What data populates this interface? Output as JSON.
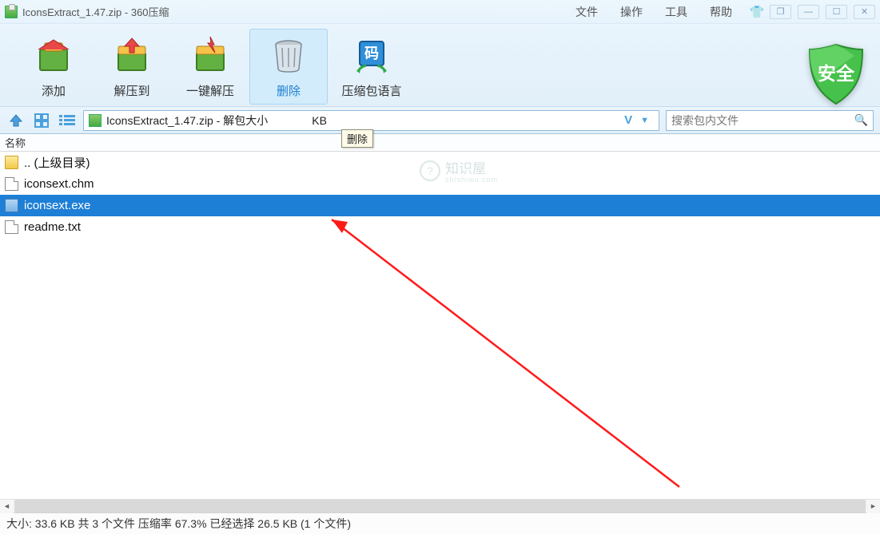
{
  "title": "IconsExtract_1.47.zip - 360压缩",
  "menus": {
    "file": "文件",
    "operation": "操作",
    "tools": "工具",
    "help": "帮助"
  },
  "toolbar": {
    "add": "添加",
    "extract_to": "解压到",
    "one_click_extract": "一键解压",
    "delete": "删除",
    "package_language": "压缩包语言"
  },
  "safe_label": "安全",
  "location": {
    "text_before": "IconsExtract_1.47.zip - 解包大小",
    "text_after": "KB",
    "tooltip": "删除"
  },
  "search": {
    "placeholder": "搜索包内文件"
  },
  "colhdr": {
    "name": "名称"
  },
  "files": {
    "parent": ".. (上级目录)",
    "items": [
      {
        "name": "iconsext.chm"
      },
      {
        "name": "iconsext.exe"
      },
      {
        "name": "readme.txt"
      }
    ],
    "selected_index": 1
  },
  "watermark": {
    "big": "知识屋",
    "small": "zhishiwu.com"
  },
  "status": "大小: 33.6 KB 共 3 个文件 压缩率 67.3% 已经选择 26.5 KB (1 个文件)"
}
